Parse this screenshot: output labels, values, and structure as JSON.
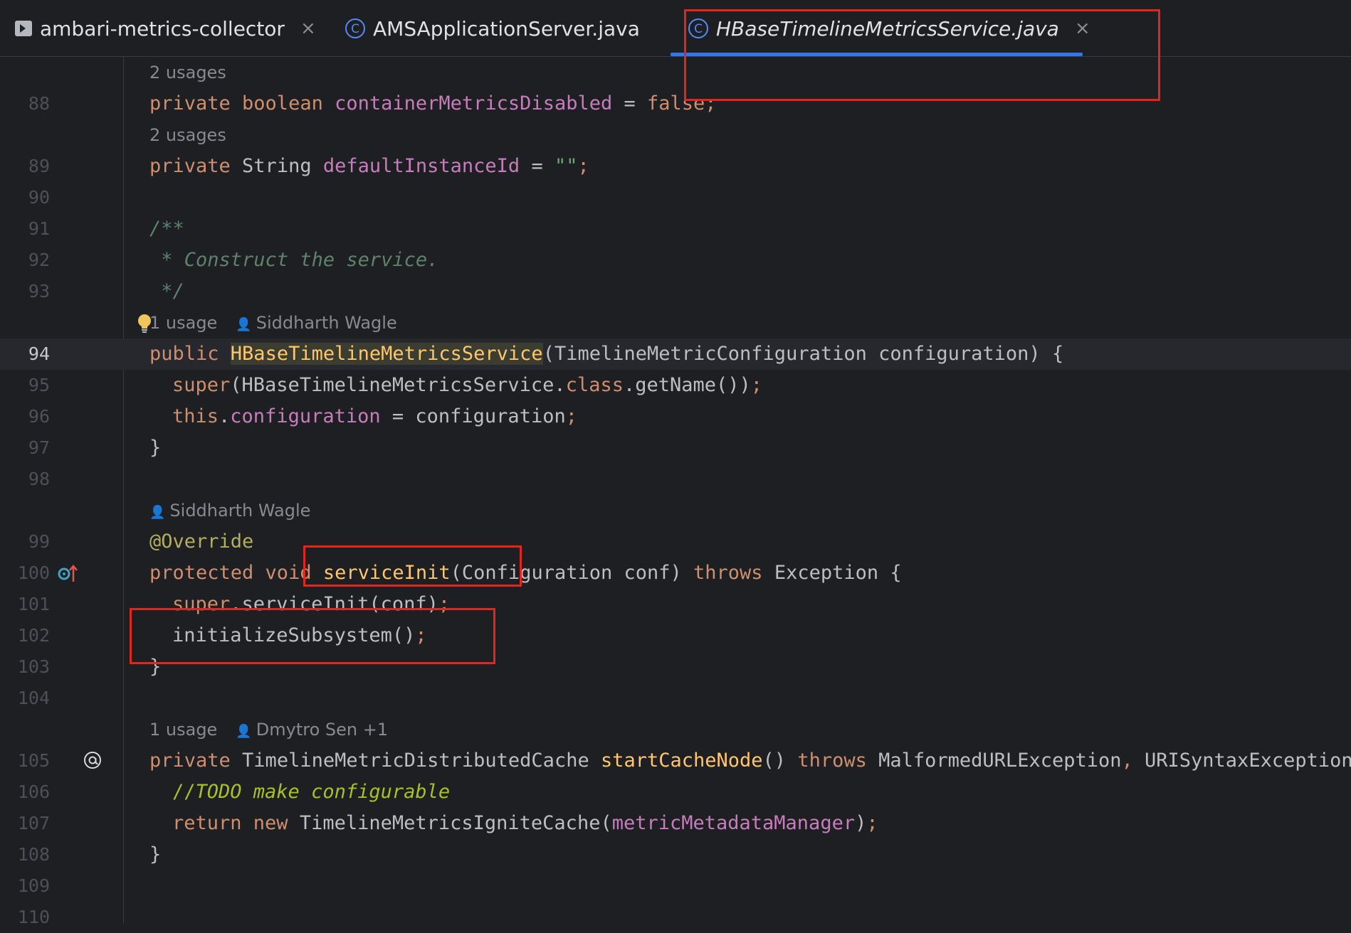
{
  "tabs": [
    {
      "label": "ambari-metrics-collector",
      "icon": "run-config-icon",
      "closable": true,
      "active": false
    },
    {
      "label": "AMSApplicationServer.java",
      "icon": "class-c-icon",
      "closable": false,
      "active": false
    },
    {
      "label": "HBaseTimelineMetricsService.java",
      "icon": "class-c-icon",
      "closable": true,
      "active": true
    }
  ],
  "tab_close_glyph": "×",
  "hints": {
    "h88": "2 usages",
    "h89": "2 usages",
    "h94_usage": "1 usage",
    "h94_author": "Siddharth Wagle",
    "h99_author": "Siddharth Wagle",
    "h105_usage": "1 usage",
    "h105_author": "Dmytro Sen +1"
  },
  "lines": {
    "l88": "88",
    "l89": "89",
    "l90": "90",
    "l91": "91",
    "l92": "92",
    "l93": "93",
    "l94": "94",
    "l95": "95",
    "l96": "96",
    "l97": "97",
    "l98": "98",
    "l99": "99",
    "l100": "100",
    "l101": "101",
    "l102": "102",
    "l103": "103",
    "l104": "104",
    "l105": "105",
    "l106": "106",
    "l107": "107",
    "l108": "108",
    "l109": "109",
    "l110": "110"
  },
  "code": {
    "c88": {
      "kw": "private boolean ",
      "name": "containerMetricsDisabled",
      "op": " = ",
      "val": "false",
      "end": ";"
    },
    "c89": {
      "kw": "private ",
      "type": "String ",
      "name": "defaultInstanceId",
      "op": " = ",
      "val": "\"\"",
      "end": ";"
    },
    "c91": "/**",
    "c92": " * Construct the service.",
    "c93": " */",
    "c94": {
      "kw": "public ",
      "name": "HBaseTimelineMetricsService",
      "rest": "(TimelineMetricConfiguration configuration) {"
    },
    "c95": {
      "kw": "super",
      "a": "(HBaseTimelineMetricsService.",
      "cls": "class",
      "b": ".getName())",
      "end": ";"
    },
    "c96": {
      "kw": "this",
      "a": ".",
      "field": "configuration",
      "b": " = configuration",
      "end": ";"
    },
    "c97": "}",
    "c99": "@Override",
    "c100": {
      "kw": "protected void ",
      "name": "serviceInit",
      "a": "(Configuration conf) ",
      "kw2": "throws ",
      "b": "Exception {"
    },
    "c101": {
      "kw": "super",
      "a": ".serviceInit(conf)",
      "end": ";"
    },
    "c102": {
      "a": "initializeSubsystem()",
      "end": ";"
    },
    "c103": "}",
    "c105": {
      "kw": "private ",
      "type": "TimelineMetricDistributedCache ",
      "name": "startCacheNode",
      "a": "() ",
      "kw2": "throws ",
      "b": "MalformedURLException",
      "comma": ", ",
      "c": "URISyntaxException -"
    },
    "c106": {
      "slash": "//",
      "todo": "TODO make configurable"
    },
    "c107": {
      "kw": "return new ",
      "a": "TimelineMetricsIgniteCache(",
      "field": "metricMetadataManager",
      "b": ")",
      "end": ";"
    },
    "c108": "}"
  },
  "colors": {
    "background": "#1e1f22",
    "keyword": "#cf8e6d",
    "field": "#c77dbb",
    "declaration": "#ffc66d",
    "annotation": "#b3ae60",
    "doc_comment": "#5f826b",
    "todo": "#a8c023",
    "active_tab_underline": "#3574f0",
    "highlight_box": "#e3261d"
  },
  "annotations": [
    "red-box-active-tab",
    "red-box-serviceInit",
    "red-box-initializeSubsystem"
  ]
}
